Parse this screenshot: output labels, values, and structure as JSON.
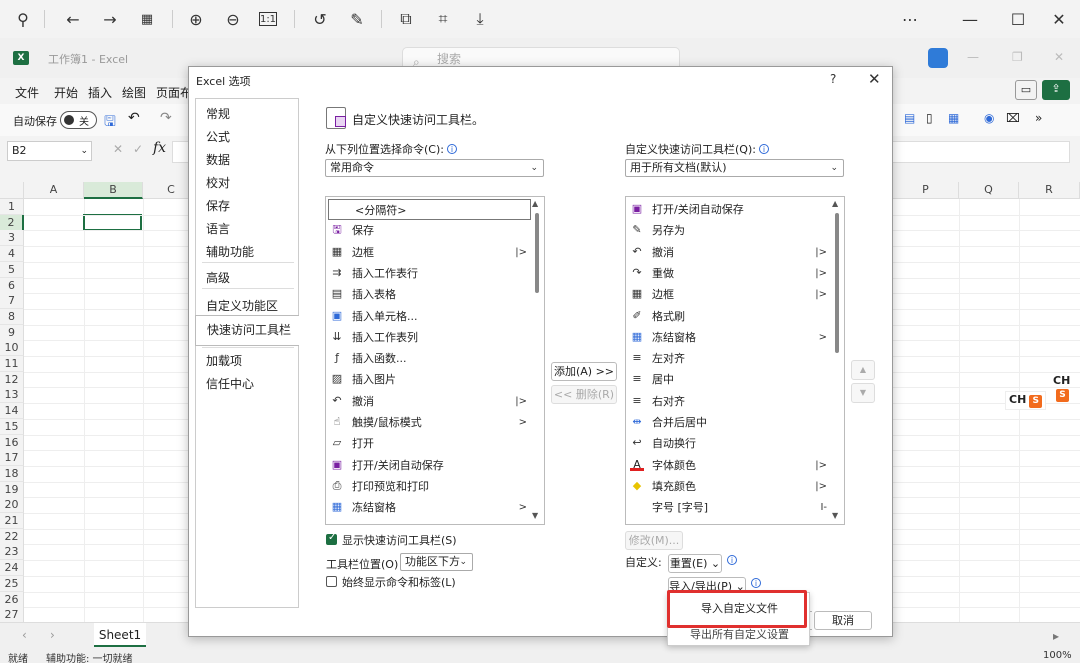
{
  "excel": {
    "doc_title": "工作簿1 - Excel",
    "search_placeholder": "搜索",
    "menu": [
      "文件",
      "开始",
      "插入",
      "绘图",
      "页面布"
    ],
    "autosave_label": "自动保存",
    "autosave_state": "关",
    "name_box": "B2",
    "fx": "fx",
    "columns": [
      "A",
      "B",
      "C",
      "P",
      "Q",
      "R"
    ],
    "rows": [
      "1",
      "2",
      "3",
      "4",
      "5",
      "6",
      "7",
      "8",
      "9",
      "10",
      "11",
      "12",
      "13",
      "14",
      "15",
      "16",
      "17",
      "18",
      "19",
      "20",
      "21",
      "22",
      "23",
      "24",
      "25",
      "26",
      "27"
    ],
    "sheet_tab": "Sheet1",
    "status_ready": "就绪",
    "status_accessibility": "辅助功能: 一切就绪",
    "zoom": "100%",
    "ime_label": "CH",
    "ime_s": "S"
  },
  "dialog": {
    "title": "Excel 选项",
    "help": "?",
    "close": "✕",
    "nav": [
      "常规",
      "公式",
      "数据",
      "校对",
      "保存",
      "语言",
      "辅助功能",
      "高级",
      "自定义功能区",
      "快速访问工具栏",
      "加载项",
      "信任中心"
    ],
    "active_nav": "快速访问工具栏",
    "section_title": "自定义快速访问工具栏。",
    "choose_from_label": "从下列位置选择命令(C):",
    "choose_from_value": "常用命令",
    "customize_label": "自定义快速访问工具栏(Q):",
    "customize_value": "用于所有文档(默认)",
    "left_list": [
      {
        "text": "<分隔符>",
        "icon": "",
        "sub": ""
      },
      {
        "text": "保存",
        "icon": "save-icon",
        "sub": ""
      },
      {
        "text": "边框",
        "icon": "border-icon",
        "sub": "|>"
      },
      {
        "text": "插入工作表行",
        "icon": "insert-row-icon",
        "sub": ""
      },
      {
        "text": "插入表格",
        "icon": "insert-table-icon",
        "sub": ""
      },
      {
        "text": "插入单元格...",
        "icon": "insert-cells-icon",
        "sub": ""
      },
      {
        "text": "插入工作表列",
        "icon": "insert-column-icon",
        "sub": ""
      },
      {
        "text": "插入函数...",
        "icon": "function-icon",
        "sub": ""
      },
      {
        "text": "插入图片",
        "icon": "picture-icon",
        "sub": ""
      },
      {
        "text": "撤消",
        "icon": "undo-icon",
        "sub": "|>"
      },
      {
        "text": "触摸/鼠标模式",
        "icon": "touch-icon",
        "sub": ">"
      },
      {
        "text": "打开",
        "icon": "open-folder-icon",
        "sub": ""
      },
      {
        "text": "打开/关闭自动保存",
        "icon": "autosave-icon",
        "sub": ""
      },
      {
        "text": "打印预览和打印",
        "icon": "print-preview-icon",
        "sub": ""
      },
      {
        "text": "冻结窗格",
        "icon": "freeze-panes-icon",
        "sub": ">"
      }
    ],
    "right_list": [
      {
        "text": "打开/关闭自动保存",
        "icon": "autosave-icon",
        "sub": ""
      },
      {
        "text": "另存为",
        "icon": "save-as-icon",
        "sub": ""
      },
      {
        "text": "撤消",
        "icon": "undo-icon",
        "sub": "|>"
      },
      {
        "text": "重做",
        "icon": "redo-icon",
        "sub": "|>"
      },
      {
        "text": "边框",
        "icon": "border-icon",
        "sub": "|>"
      },
      {
        "text": "格式刷",
        "icon": "format-painter-icon",
        "sub": ""
      },
      {
        "text": "冻结窗格",
        "icon": "freeze-panes-icon",
        "sub": ">"
      },
      {
        "text": "左对齐",
        "icon": "align-left-icon",
        "sub": ""
      },
      {
        "text": "居中",
        "icon": "align-center-icon",
        "sub": ""
      },
      {
        "text": "右对齐",
        "icon": "align-right-icon",
        "sub": ""
      },
      {
        "text": "合并后居中",
        "icon": "merge-center-icon",
        "sub": ""
      },
      {
        "text": "自动换行",
        "icon": "wrap-text-icon",
        "sub": ""
      },
      {
        "text": "字体颜色",
        "icon": "font-color-icon",
        "sub": "|>"
      },
      {
        "text": "填充颜色",
        "icon": "fill-color-icon",
        "sub": "|>"
      },
      {
        "text": "字号 [字号]",
        "icon": "",
        "sub": "I-"
      }
    ],
    "add_button": "添加(A) >>",
    "remove_button": "<< 删除(R)",
    "modify_button": "修改(M)...",
    "show_toolbar_label": "显示快速访问工具栏(S)",
    "toolbar_position_label": "工具栏位置(O)",
    "toolbar_position_value": "功能区下方",
    "always_show_labels": "始终显示命令和标签(L)",
    "customize_short": "自定义:",
    "reset_button": "重置(E) ⌄",
    "import_export_button": "导入/导出(P) ⌄",
    "cancel_button": "取消",
    "popup_items": [
      "导入自定义文件",
      "导出所有自定义设置"
    ]
  },
  "colors": {
    "excel_green": "#1d6f42",
    "highlight_red": "#e0302e",
    "info_blue": "#2f6ad8"
  }
}
